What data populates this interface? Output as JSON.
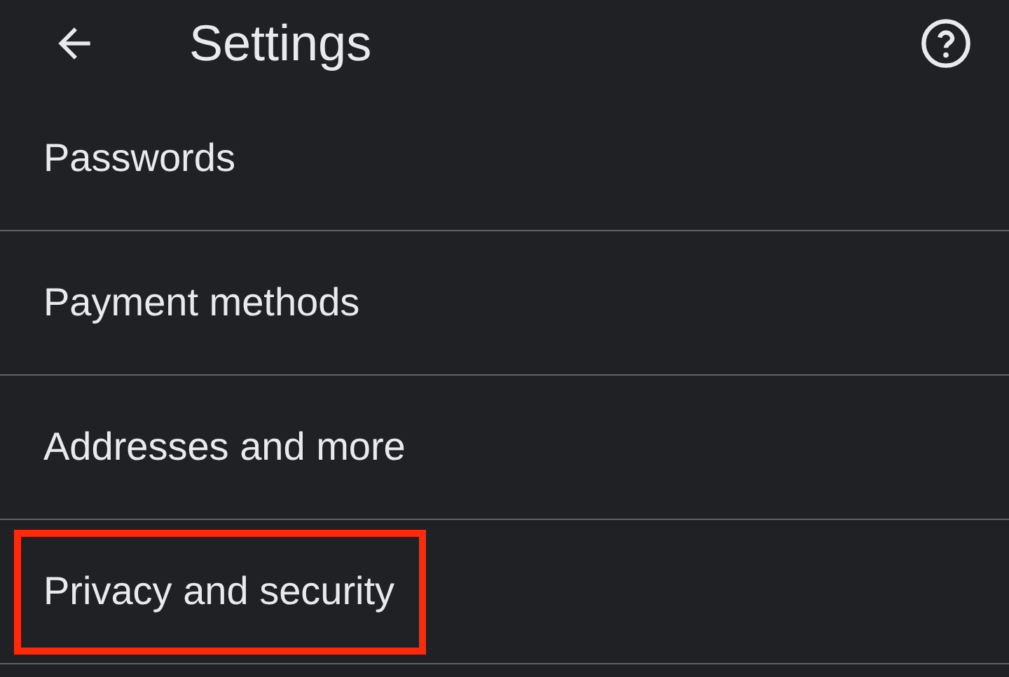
{
  "header": {
    "title": "Settings"
  },
  "items": [
    {
      "label": "Passwords",
      "highlighted": false
    },
    {
      "label": "Payment methods",
      "highlighted": false
    },
    {
      "label": "Addresses and more",
      "highlighted": false
    },
    {
      "label": "Privacy and security",
      "highlighted": true
    }
  ]
}
